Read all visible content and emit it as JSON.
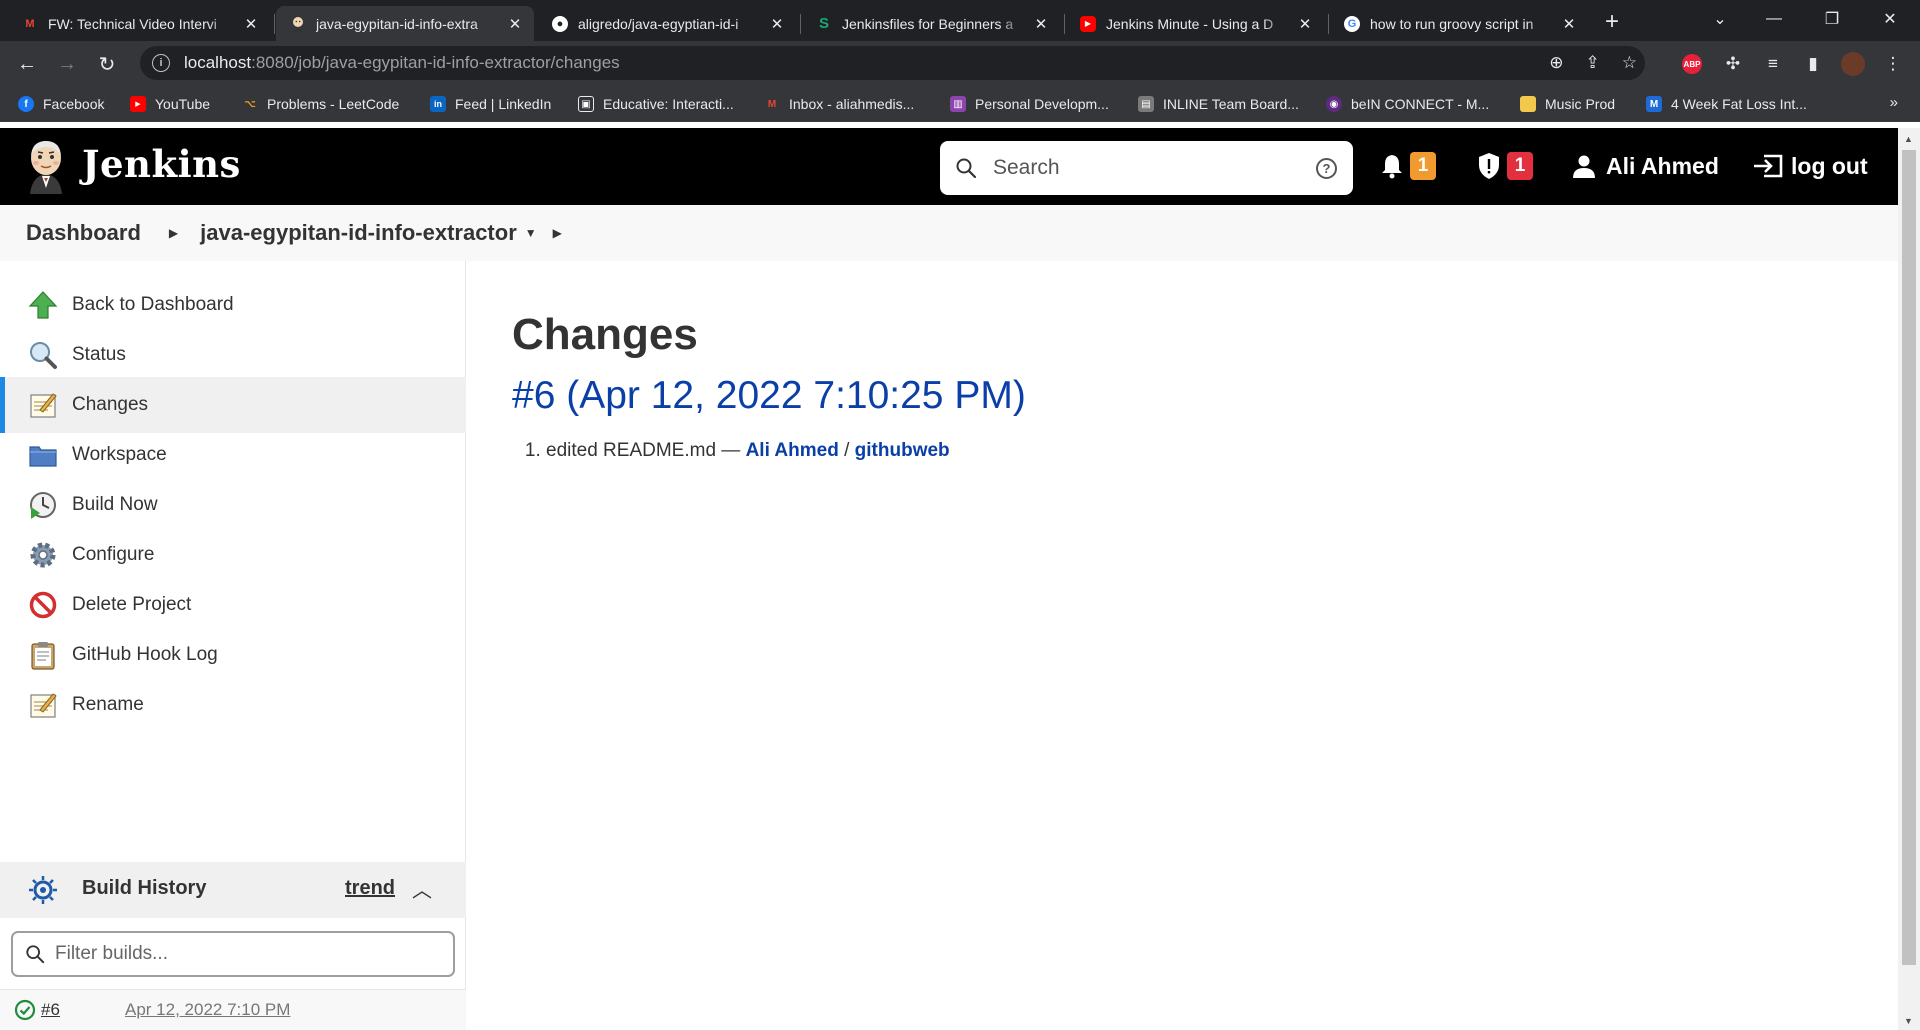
{
  "browser": {
    "tabs": [
      {
        "title": "FW: Technical Video Intervi",
        "icon": "gmail-icon"
      },
      {
        "title": "java-egypitan-id-info-extra",
        "icon": "jenkins-icon",
        "active": true
      },
      {
        "title": "aligredo/java-egyptian-id-i",
        "icon": "github-icon"
      },
      {
        "title": "Jenkinsfiles for Beginners a",
        "icon": "semaphore-icon"
      },
      {
        "title": "Jenkins Minute - Using a D",
        "icon": "youtube-icon"
      },
      {
        "title": "how to run groovy script in",
        "icon": "google-icon"
      }
    ],
    "url_host": "localhost",
    "url_rest": ":8080/job/java-egypitan-id-info-extractor/changes",
    "bookmarks": [
      {
        "label": "Facebook",
        "color": "#1877f2",
        "glyph": "f"
      },
      {
        "label": "YouTube",
        "color": "#ff0000",
        "glyph": "▶"
      },
      {
        "label": "Problems - LeetCode",
        "color": "#f89f1b",
        "glyph": "⌥"
      },
      {
        "label": "Feed | LinkedIn",
        "color": "#0a66c2",
        "glyph": "in"
      },
      {
        "label": "Educative: Interacti...",
        "color": "#5a5a5a",
        "glyph": "▣"
      },
      {
        "label": "Inbox - aliahmedis...",
        "color": "#ea4335",
        "glyph": "M"
      },
      {
        "label": "Personal Developm...",
        "color": "#8e44ad",
        "glyph": "▥"
      },
      {
        "label": "INLINE Team Board...",
        "color": "#7a7a7a",
        "glyph": "▤"
      },
      {
        "label": "beIN CONNECT - M...",
        "color": "#5e2b82",
        "glyph": "◉"
      },
      {
        "label": "Music Prod",
        "color": "#f2c94c",
        "glyph": ""
      },
      {
        "label": "4 Week Fat Loss Int...",
        "color": "#1e6bd6",
        "glyph": "M"
      }
    ]
  },
  "jenkins": {
    "title": "Jenkins",
    "search_placeholder": "Search",
    "notifications_count": "1",
    "security_count": "1",
    "user": "Ali Ahmed",
    "logout": "log out",
    "colors": {
      "link": "#0b3fa8",
      "active_border": "#1e88e5",
      "warn": "#f19a2f",
      "danger": "#e2303f"
    }
  },
  "breadcrumb": {
    "root": "Dashboard",
    "job": "java-egypitan-id-info-extractor"
  },
  "sidebar": {
    "tasks": [
      {
        "label": "Back to Dashboard",
        "icon": "up-arrow-icon"
      },
      {
        "label": "Status",
        "icon": "magnifier-icon"
      },
      {
        "label": "Changes",
        "icon": "notepad-icon"
      },
      {
        "label": "Workspace",
        "icon": "folder-icon"
      },
      {
        "label": "Build Now",
        "icon": "clock-play-icon"
      },
      {
        "label": "Configure",
        "icon": "gear-icon"
      },
      {
        "label": "Delete Project",
        "icon": "no-entry-icon"
      },
      {
        "label": "GitHub Hook Log",
        "icon": "clipboard-icon"
      },
      {
        "label": "Rename",
        "icon": "notepad-icon"
      }
    ],
    "build_history": {
      "title": "Build History",
      "trend": "trend",
      "filter_placeholder": "Filter builds...",
      "builds": [
        {
          "number": "#6",
          "date": "Apr 12, 2022 7:10 PM",
          "status": "success"
        }
      ]
    }
  },
  "main": {
    "heading": "Changes",
    "build_title": "#6 (Apr 12, 2022 7:10:25 PM)",
    "changes": [
      {
        "message": "edited README.md — ",
        "author": "Ali Ahmed",
        "sep": " / ",
        "link": "githubweb"
      }
    ]
  }
}
